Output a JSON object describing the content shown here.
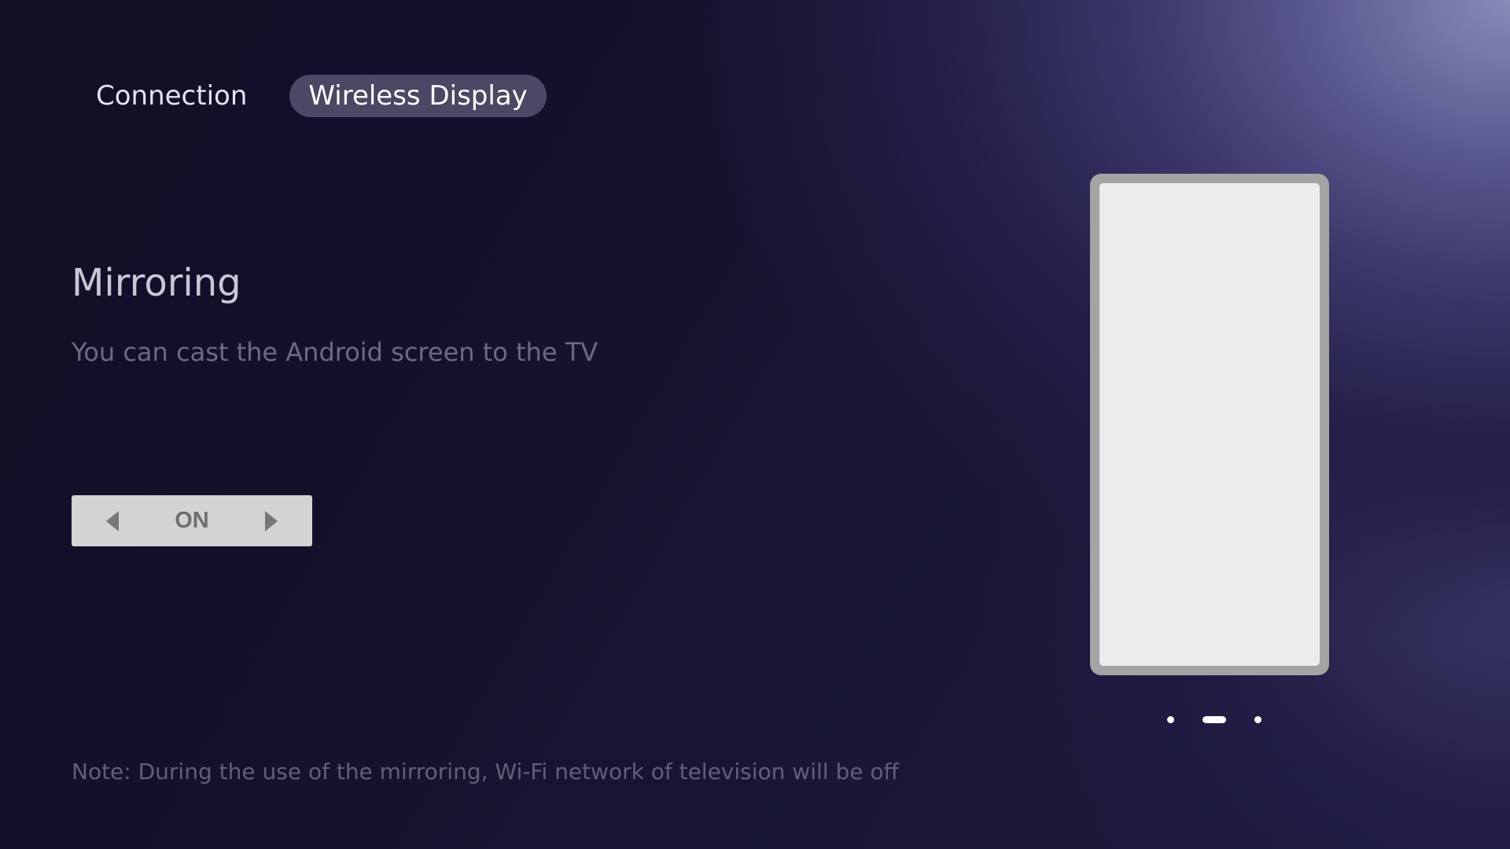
{
  "tabs": [
    {
      "label": "Connection",
      "active": false
    },
    {
      "label": "Wireless Display",
      "active": true
    }
  ],
  "mirroring": {
    "title": "Mirroring",
    "description": "You can cast the Android screen to the TV",
    "value": "ON",
    "left_icon": "caret-left-icon",
    "right_icon": "caret-right-icon"
  },
  "note": "Note: During the use of the mirroring, Wi-Fi network of television will be off",
  "pager": {
    "count": 3,
    "active_index": 1
  },
  "colors": {
    "background_dark": "#110f25",
    "background_light": "#8a8ab8",
    "tab_active_bg": "#78769a",
    "selector_bg": "#d3d3d3",
    "phone_frame": "#a4a4a4",
    "phone_screen": "#ececec"
  }
}
